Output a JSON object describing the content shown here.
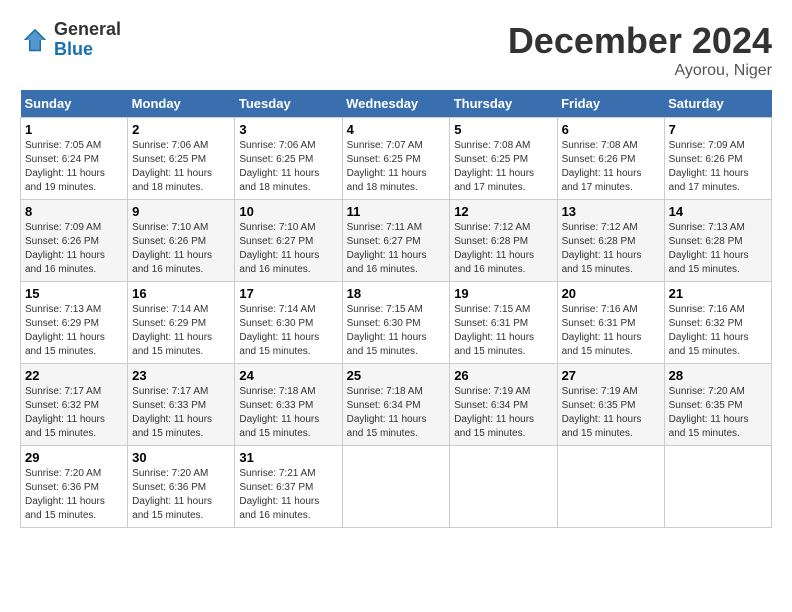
{
  "logo": {
    "general": "General",
    "blue": "Blue"
  },
  "title": "December 2024",
  "location": "Ayorou, Niger",
  "weekdays": [
    "Sunday",
    "Monday",
    "Tuesday",
    "Wednesday",
    "Thursday",
    "Friday",
    "Saturday"
  ],
  "weeks": [
    [
      {
        "day": "1",
        "sunrise": "7:05 AM",
        "sunset": "6:24 PM",
        "daylight": "11 hours and 19 minutes."
      },
      {
        "day": "2",
        "sunrise": "7:06 AM",
        "sunset": "6:25 PM",
        "daylight": "11 hours and 18 minutes."
      },
      {
        "day": "3",
        "sunrise": "7:06 AM",
        "sunset": "6:25 PM",
        "daylight": "11 hours and 18 minutes."
      },
      {
        "day": "4",
        "sunrise": "7:07 AM",
        "sunset": "6:25 PM",
        "daylight": "11 hours and 18 minutes."
      },
      {
        "day": "5",
        "sunrise": "7:08 AM",
        "sunset": "6:25 PM",
        "daylight": "11 hours and 17 minutes."
      },
      {
        "day": "6",
        "sunrise": "7:08 AM",
        "sunset": "6:26 PM",
        "daylight": "11 hours and 17 minutes."
      },
      {
        "day": "7",
        "sunrise": "7:09 AM",
        "sunset": "6:26 PM",
        "daylight": "11 hours and 17 minutes."
      }
    ],
    [
      {
        "day": "8",
        "sunrise": "7:09 AM",
        "sunset": "6:26 PM",
        "daylight": "11 hours and 16 minutes."
      },
      {
        "day": "9",
        "sunrise": "7:10 AM",
        "sunset": "6:26 PM",
        "daylight": "11 hours and 16 minutes."
      },
      {
        "day": "10",
        "sunrise": "7:10 AM",
        "sunset": "6:27 PM",
        "daylight": "11 hours and 16 minutes."
      },
      {
        "day": "11",
        "sunrise": "7:11 AM",
        "sunset": "6:27 PM",
        "daylight": "11 hours and 16 minutes."
      },
      {
        "day": "12",
        "sunrise": "7:12 AM",
        "sunset": "6:28 PM",
        "daylight": "11 hours and 16 minutes."
      },
      {
        "day": "13",
        "sunrise": "7:12 AM",
        "sunset": "6:28 PM",
        "daylight": "11 hours and 15 minutes."
      },
      {
        "day": "14",
        "sunrise": "7:13 AM",
        "sunset": "6:28 PM",
        "daylight": "11 hours and 15 minutes."
      }
    ],
    [
      {
        "day": "15",
        "sunrise": "7:13 AM",
        "sunset": "6:29 PM",
        "daylight": "11 hours and 15 minutes."
      },
      {
        "day": "16",
        "sunrise": "7:14 AM",
        "sunset": "6:29 PM",
        "daylight": "11 hours and 15 minutes."
      },
      {
        "day": "17",
        "sunrise": "7:14 AM",
        "sunset": "6:30 PM",
        "daylight": "11 hours and 15 minutes."
      },
      {
        "day": "18",
        "sunrise": "7:15 AM",
        "sunset": "6:30 PM",
        "daylight": "11 hours and 15 minutes."
      },
      {
        "day": "19",
        "sunrise": "7:15 AM",
        "sunset": "6:31 PM",
        "daylight": "11 hours and 15 minutes."
      },
      {
        "day": "20",
        "sunrise": "7:16 AM",
        "sunset": "6:31 PM",
        "daylight": "11 hours and 15 minutes."
      },
      {
        "day": "21",
        "sunrise": "7:16 AM",
        "sunset": "6:32 PM",
        "daylight": "11 hours and 15 minutes."
      }
    ],
    [
      {
        "day": "22",
        "sunrise": "7:17 AM",
        "sunset": "6:32 PM",
        "daylight": "11 hours and 15 minutes."
      },
      {
        "day": "23",
        "sunrise": "7:17 AM",
        "sunset": "6:33 PM",
        "daylight": "11 hours and 15 minutes."
      },
      {
        "day": "24",
        "sunrise": "7:18 AM",
        "sunset": "6:33 PM",
        "daylight": "11 hours and 15 minutes."
      },
      {
        "day": "25",
        "sunrise": "7:18 AM",
        "sunset": "6:34 PM",
        "daylight": "11 hours and 15 minutes."
      },
      {
        "day": "26",
        "sunrise": "7:19 AM",
        "sunset": "6:34 PM",
        "daylight": "11 hours and 15 minutes."
      },
      {
        "day": "27",
        "sunrise": "7:19 AM",
        "sunset": "6:35 PM",
        "daylight": "11 hours and 15 minutes."
      },
      {
        "day": "28",
        "sunrise": "7:20 AM",
        "sunset": "6:35 PM",
        "daylight": "11 hours and 15 minutes."
      }
    ],
    [
      {
        "day": "29",
        "sunrise": "7:20 AM",
        "sunset": "6:36 PM",
        "daylight": "11 hours and 15 minutes."
      },
      {
        "day": "30",
        "sunrise": "7:20 AM",
        "sunset": "6:36 PM",
        "daylight": "11 hours and 15 minutes."
      },
      {
        "day": "31",
        "sunrise": "7:21 AM",
        "sunset": "6:37 PM",
        "daylight": "11 hours and 16 minutes."
      },
      null,
      null,
      null,
      null
    ]
  ]
}
